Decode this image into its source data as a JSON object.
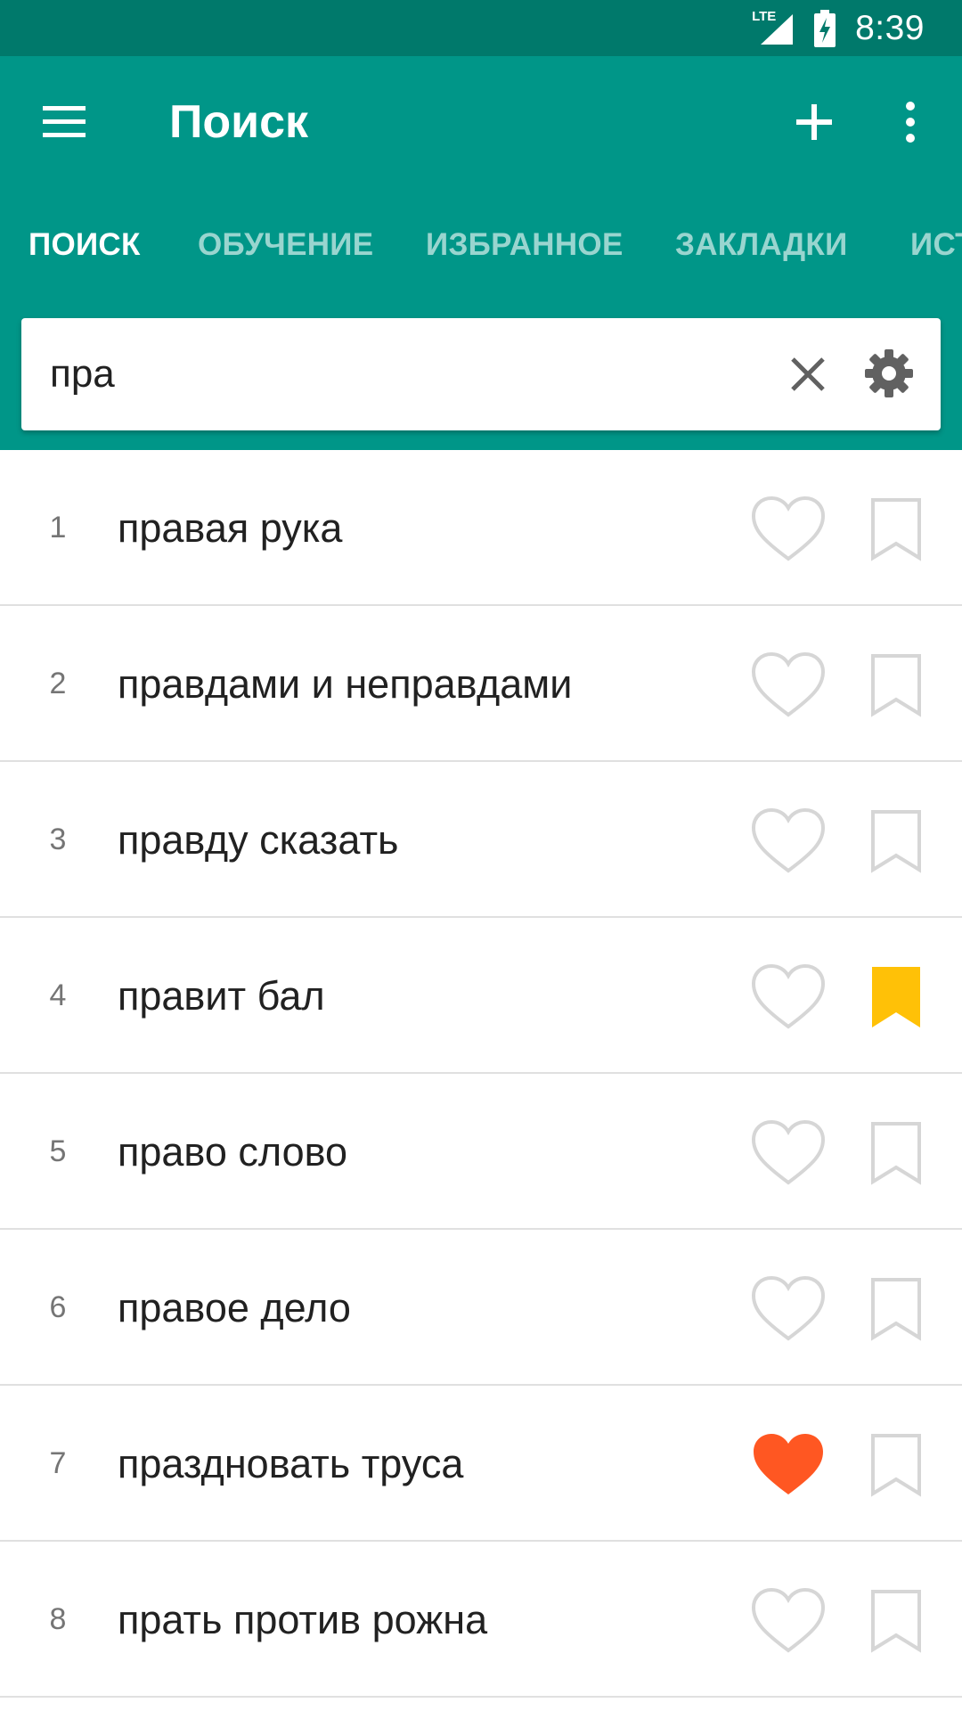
{
  "status_bar": {
    "network": "LTE",
    "time": "8:39"
  },
  "toolbar": {
    "title": "Поиск",
    "menu_icon": "hamburger-menu-icon",
    "add_icon": "plus-icon",
    "more_icon": "more-vert-icon"
  },
  "tabs": [
    {
      "label": "ПОИСК",
      "active": true
    },
    {
      "label": "ОБУЧЕНИЕ",
      "active": false
    },
    {
      "label": "ИЗБРАННОЕ",
      "active": false
    },
    {
      "label": "ЗАКЛАДКИ",
      "active": false
    },
    {
      "label": "ИСТ",
      "active": false
    }
  ],
  "search": {
    "value": "пра",
    "clear_icon": "close-icon",
    "settings_icon": "gear-icon"
  },
  "results": [
    {
      "num": "1",
      "text": "правая рука",
      "favorite": false,
      "bookmarked": false
    },
    {
      "num": "2",
      "text": "правдами и неправдами",
      "favorite": false,
      "bookmarked": false
    },
    {
      "num": "3",
      "text": "правду сказать",
      "favorite": false,
      "bookmarked": false
    },
    {
      "num": "4",
      "text": "правит бал",
      "favorite": false,
      "bookmarked": true
    },
    {
      "num": "5",
      "text": "право слово",
      "favorite": false,
      "bookmarked": false
    },
    {
      "num": "6",
      "text": "правое дело",
      "favorite": false,
      "bookmarked": false
    },
    {
      "num": "7",
      "text": "праздновать труса",
      "favorite": true,
      "bookmarked": false
    },
    {
      "num": "8",
      "text": "прать против рожна",
      "favorite": false,
      "bookmarked": false
    }
  ],
  "colors": {
    "status_bar": "#00796b",
    "primary": "#009688",
    "favorite": "#ff5722",
    "bookmark": "#ffc107",
    "icon_inactive": "#d6d6d6"
  }
}
